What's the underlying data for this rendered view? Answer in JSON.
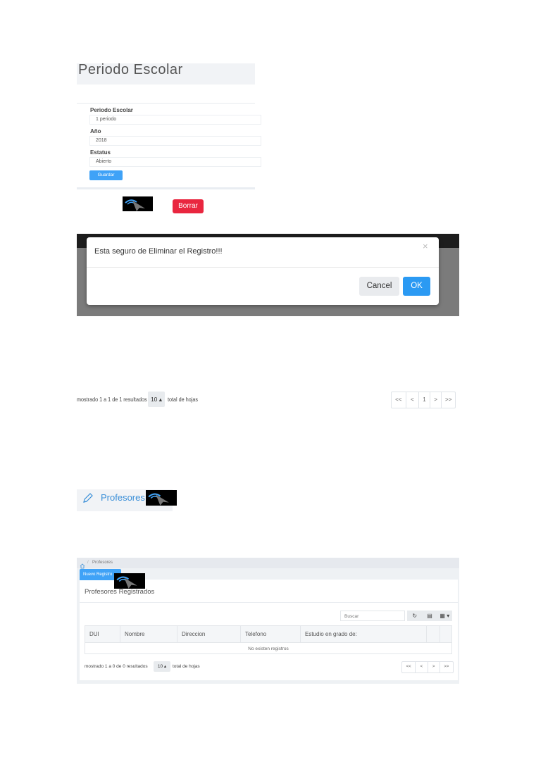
{
  "periodo_form": {
    "title": "Periodo Escolar",
    "fields": [
      {
        "label": "Periodo Escolar",
        "value": "1 periodo"
      },
      {
        "label": "Año",
        "value": "2018"
      },
      {
        "label": "Estatus",
        "value": "Abierto"
      }
    ],
    "save_label": "Guardar",
    "delete_label": "Borrar"
  },
  "confirm_modal": {
    "message": "Esta seguro de Eliminar el Registro!!!",
    "close_glyph": "×",
    "cancel_label": "Cancel",
    "ok_label": "OK"
  },
  "pagination_large": {
    "summary": "mostrado 1 a 1 de 1 resultados",
    "page_size": "10 ▴",
    "total_label": "total de hojas",
    "pages": [
      "<<",
      "<",
      "1",
      ">",
      ">>"
    ]
  },
  "profesores_nav": {
    "label": "Profesores"
  },
  "profesores_page": {
    "breadcrumb": "Profesores",
    "breadcrumb_separator": "/",
    "new_button": "Nuevo Registro",
    "panel_title": "Profesores Registrados",
    "search_placeholder": "Buscar",
    "tools": [
      "↻",
      "▤",
      "▦ ▾"
    ],
    "columns": [
      "DUI",
      "Nombre",
      "Direccion",
      "Telefono",
      "Estudio en grado de:",
      "",
      ""
    ],
    "empty_message": "No existen registros",
    "pagination": {
      "summary": "mostrado 1 a 0 de 0 resultados",
      "page_size": "10 ▴",
      "total_label": "total de hojas",
      "pages": [
        "<<",
        "<",
        ">",
        ">>"
      ]
    }
  },
  "colors": {
    "primary": "#3fa2f7",
    "danger": "#e9263f",
    "link": "#3a8fd8"
  },
  "icons": [
    "cursor-icon",
    "pencil-icon",
    "home-icon",
    "refresh-icon",
    "list-icon",
    "columns-icon",
    "close-icon"
  ]
}
